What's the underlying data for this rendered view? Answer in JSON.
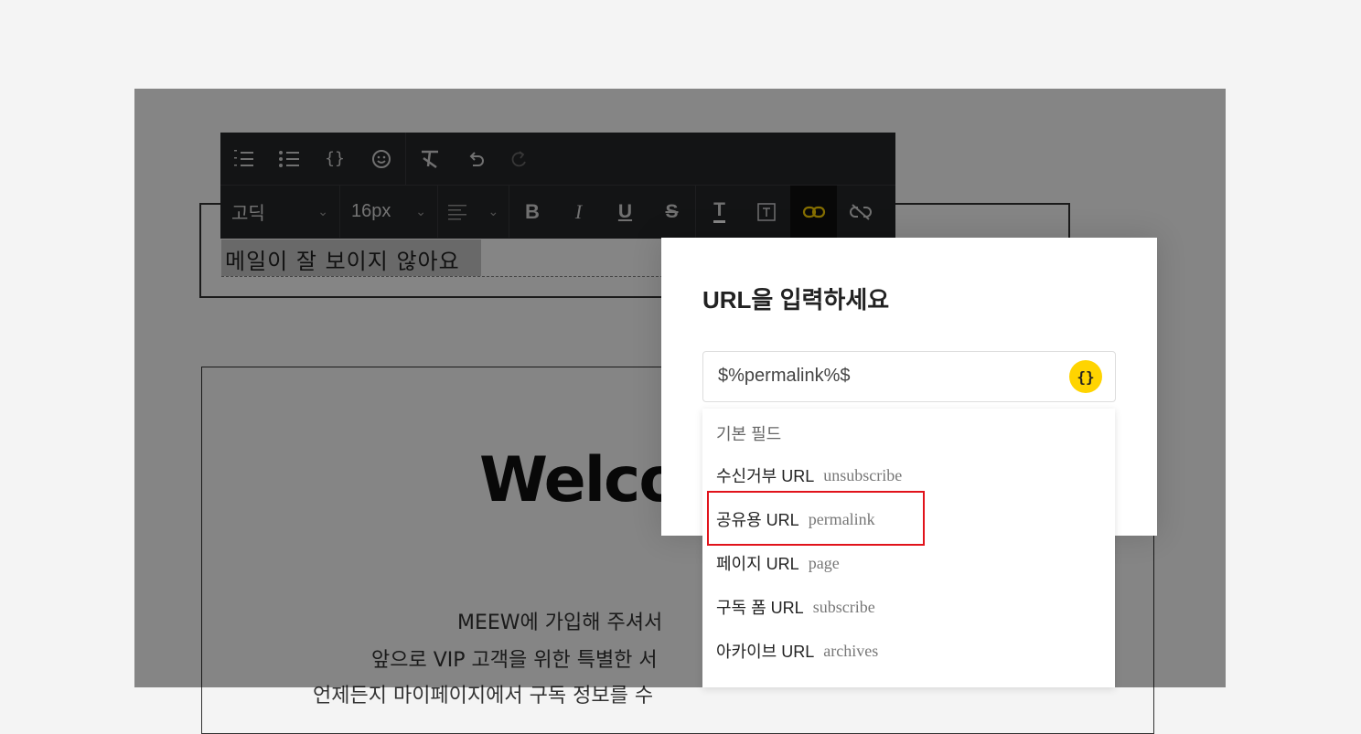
{
  "toolbar": {
    "font_family": "고딕",
    "font_size": "16px",
    "icons_row1": [
      "ordered-list-icon",
      "unordered-list-icon",
      "variable-braces-icon",
      "emoji-icon",
      "clear-format-icon",
      "undo-icon",
      "redo-icon"
    ],
    "braces_glyph": "{}"
  },
  "editor": {
    "subject": "메일이 잘 보이지 않아요",
    "welcome": "Welco",
    "body_lines": [
      "MEEW에 가입해 주셔서 ",
      "앞으로 VIP 고객을 위한 특별한 서",
      "언제든지 마이페이지에서 구독 정보를 수"
    ]
  },
  "modal": {
    "title": "URL을 입력하세요",
    "input_value": "$%permalink%$",
    "var_button": "{}"
  },
  "dropdown": {
    "header": "기본 필드",
    "items": [
      {
        "label": "수신거부 URL",
        "key": "unsubscribe"
      },
      {
        "label": "공유용 URL",
        "key": "permalink"
      },
      {
        "label": "페이지 URL",
        "key": "page"
      },
      {
        "label": "구독 폼 URL",
        "key": "subscribe"
      },
      {
        "label": "아카이브 URL",
        "key": "archives"
      }
    ]
  },
  "colors": {
    "accent_yellow": "#ffd400",
    "highlight_red": "#e1131b",
    "toolbar_bg": "#26272a"
  }
}
